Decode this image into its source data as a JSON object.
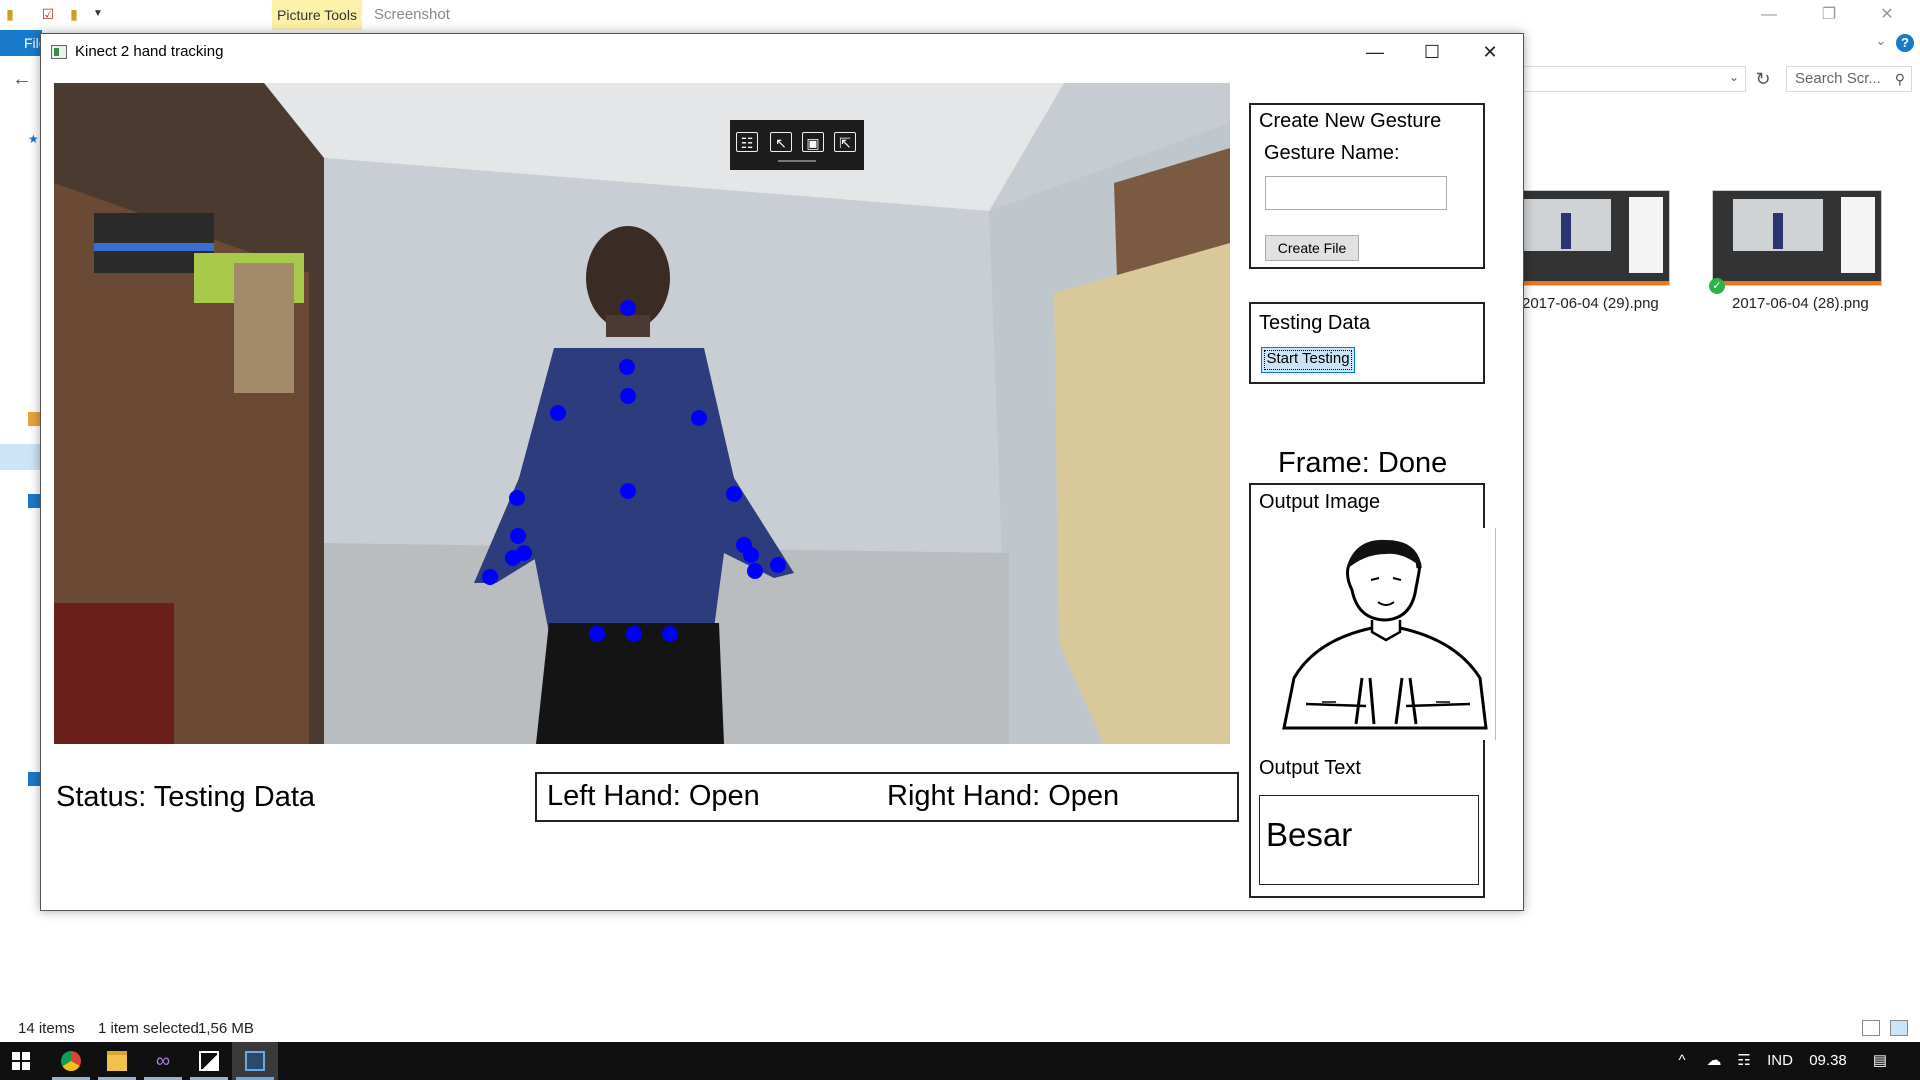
{
  "explorer": {
    "picture_tools_tab": "Picture Tools",
    "screenshot_tab": "Screenshot",
    "file_tab": "File",
    "search_placeholder": "Search Scr...",
    "thumbnails": [
      {
        "label": "2017-06-04 (29).png"
      },
      {
        "label": "2017-06-04 (28).png"
      }
    ],
    "status": {
      "items": "14 items",
      "selected": "1 item selected",
      "size": "1,56 MB"
    },
    "icons": [
      "folder-icon",
      "checkbox-icon",
      "back-arrow-icon",
      "refresh-icon",
      "search-icon",
      "help-icon"
    ]
  },
  "kinect_window": {
    "title": "Kinect 2 hand tracking",
    "create_gesture": {
      "title": "Create New Gesture",
      "name_label": "Gesture Name:",
      "name_value": "",
      "create_button": "Create File"
    },
    "testing": {
      "title": "Testing Data",
      "start_button": "Start Testing"
    },
    "frame_status": "Frame: Done",
    "output_image_label": "Output Image",
    "output_text_label": "Output Text",
    "output_text_value": "Besar",
    "status": "Status: Testing Data",
    "left_hand": "Left Hand: Open",
    "right_hand": "Right Hand: Open",
    "skeleton_joint_color": "#0000ff"
  },
  "taskbar": {
    "apps": [
      "windows-start-icon",
      "chrome-icon",
      "file-explorer-icon",
      "visual-studio-icon",
      "photos-icon",
      "kinect-app-icon"
    ],
    "language": "IND",
    "time": "09.38"
  }
}
